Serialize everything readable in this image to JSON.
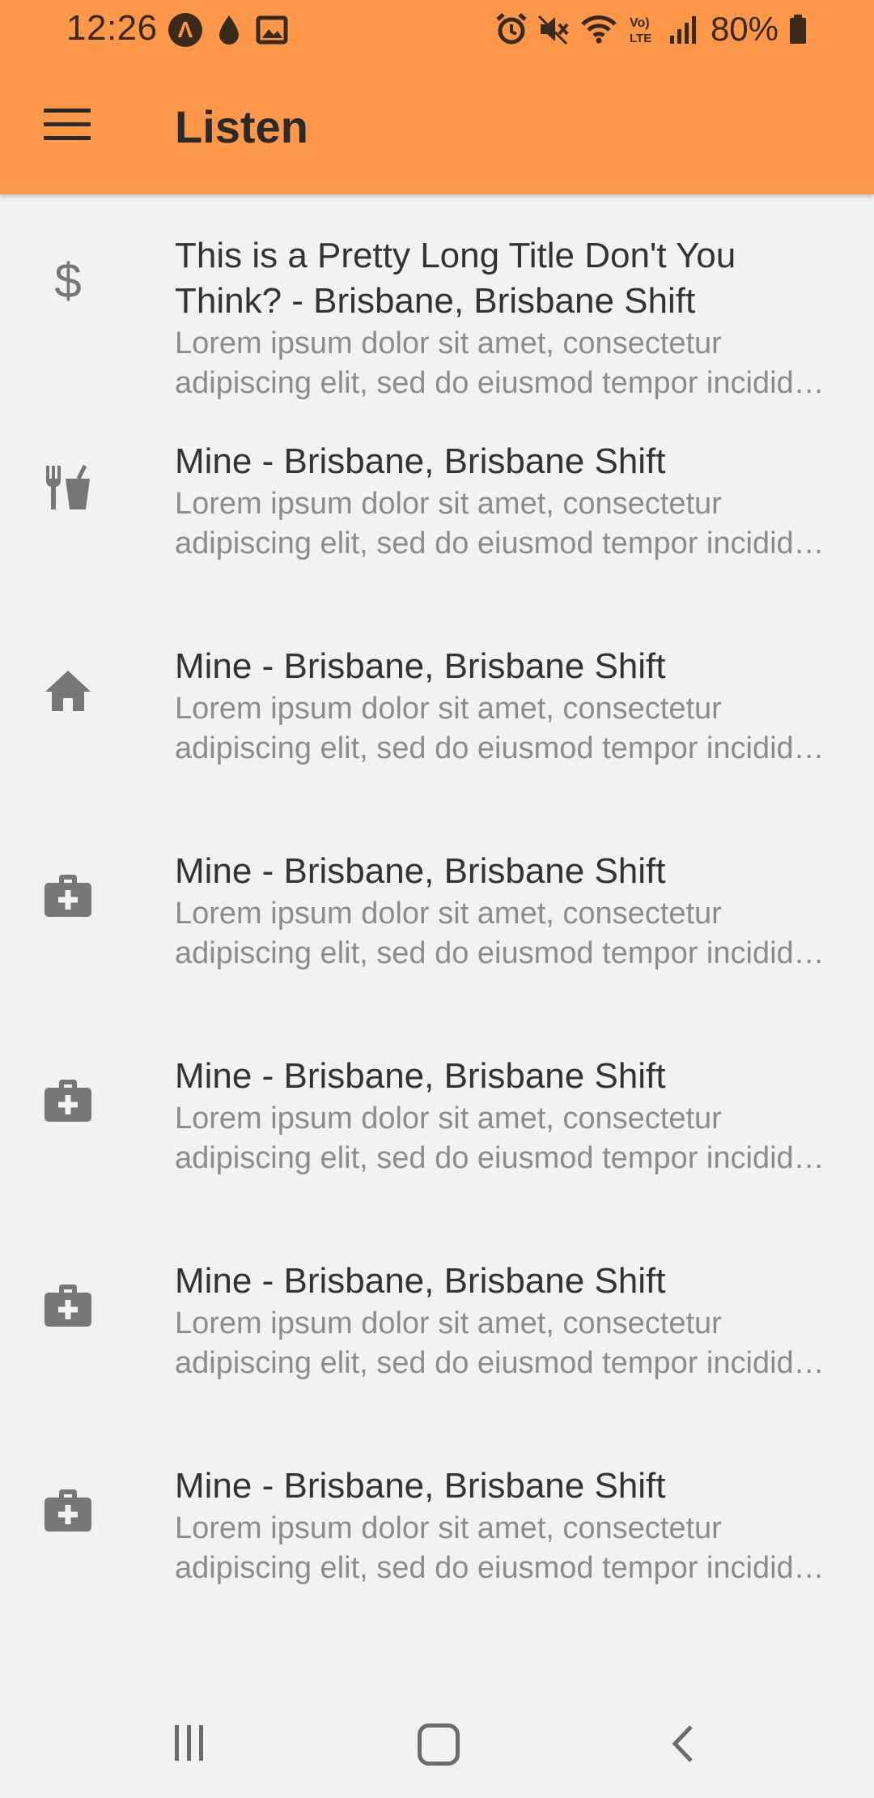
{
  "status": {
    "time": "12:26",
    "battery": "80%"
  },
  "appbar": {
    "title": "Listen"
  },
  "items": [
    {
      "icon": "dollar-icon",
      "title": "This is a Pretty Long Title Don't You Think? - Brisbane, Brisbane Shift",
      "description": "Lorem ipsum dolor sit amet, consectetur adipiscing elit, sed do eiusmod tempor incididunt ut labore et dolore magna aliqua."
    },
    {
      "icon": "restaurant-icon",
      "title": "Mine - Brisbane, Brisbane Shift",
      "description": "Lorem ipsum dolor sit amet, consectetur adipiscing elit, sed do eiusmod tempor incididunt ut labore et dolore magna aliqua."
    },
    {
      "icon": "home-icon",
      "title": "Mine - Brisbane, Brisbane Shift",
      "description": "Lorem ipsum dolor sit amet, consectetur adipiscing elit, sed do eiusmod tempor incididunt ut labore et dolore magna aliqua."
    },
    {
      "icon": "medical-bag-icon",
      "title": "Mine - Brisbane, Brisbane Shift",
      "description": "Lorem ipsum dolor sit amet, consectetur adipiscing elit, sed do eiusmod tempor incididunt ut labore et dolore magna aliqua."
    },
    {
      "icon": "medical-bag-icon",
      "title": "Mine - Brisbane, Brisbane Shift",
      "description": "Lorem ipsum dolor sit amet, consectetur adipiscing elit, sed do eiusmod tempor incididunt ut labore et dolore magna aliqua."
    },
    {
      "icon": "medical-bag-icon",
      "title": "Mine - Brisbane, Brisbane Shift",
      "description": "Lorem ipsum dolor sit amet, consectetur adipiscing elit, sed do eiusmod tempor incididunt ut labore et dolore magna aliqua."
    },
    {
      "icon": "medical-bag-icon",
      "title": "Mine - Brisbane, Brisbane Shift",
      "description": "Lorem ipsum dolor sit amet, consectetur adipiscing elit, sed do eiusmod tempor incididunt ut labore et dolore magna aliqua."
    }
  ],
  "colors": {
    "appbar": "#fd984b",
    "background": "#f2f2f2",
    "title_text": "#333333",
    "secondary_text": "#8c8c8c",
    "icon": "#777777"
  }
}
